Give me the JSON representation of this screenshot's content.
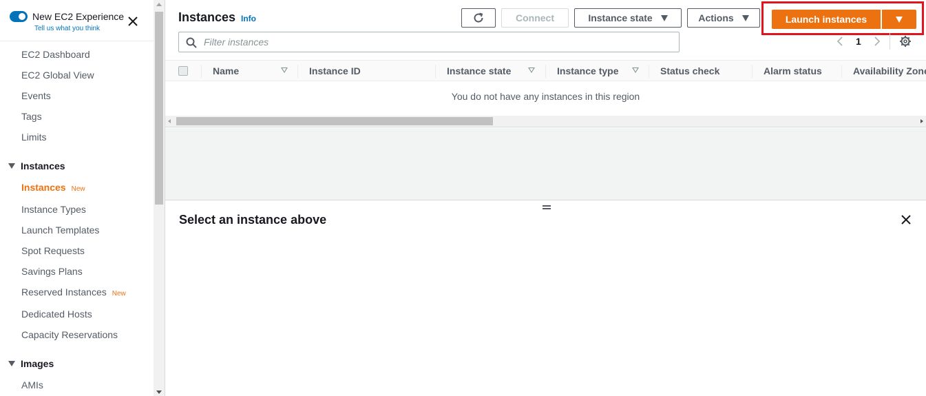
{
  "sidebar": {
    "toggle_label": "New EC2 Experience",
    "toggle_sub": "Tell us what you think",
    "items_top": [
      "EC2 Dashboard",
      "EC2 Global View",
      "Events",
      "Tags",
      "Limits"
    ],
    "section_instances": "Instances",
    "instances_items": [
      {
        "label": "Instances",
        "badge": "New"
      },
      {
        "label": "Instance Types",
        "badge": ""
      },
      {
        "label": "Launch Templates",
        "badge": ""
      },
      {
        "label": "Spot Requests",
        "badge": ""
      },
      {
        "label": "Savings Plans",
        "badge": ""
      },
      {
        "label": "Reserved Instances",
        "badge": "New"
      },
      {
        "label": "Dedicated Hosts",
        "badge": ""
      },
      {
        "label": "Capacity Reservations",
        "badge": ""
      }
    ],
    "section_images": "Images",
    "images_items": [
      "AMIs"
    ]
  },
  "header": {
    "title": "Instances",
    "info": "Info",
    "connect_label": "Connect",
    "instance_state_label": "Instance state",
    "actions_label": "Actions",
    "launch_label": "Launch instances"
  },
  "filter": {
    "placeholder": "Filter instances"
  },
  "pagination": {
    "page": "1"
  },
  "table": {
    "columns": [
      "Name",
      "Instance ID",
      "Instance state",
      "Instance type",
      "Status check",
      "Alarm status",
      "Availability Zone"
    ],
    "empty_message": "You do not have any instances in this region"
  },
  "detail": {
    "title": "Select an instance above"
  },
  "colors": {
    "accent": "#ec7211",
    "link": "#0073bb",
    "highlight": "#e0141e"
  }
}
